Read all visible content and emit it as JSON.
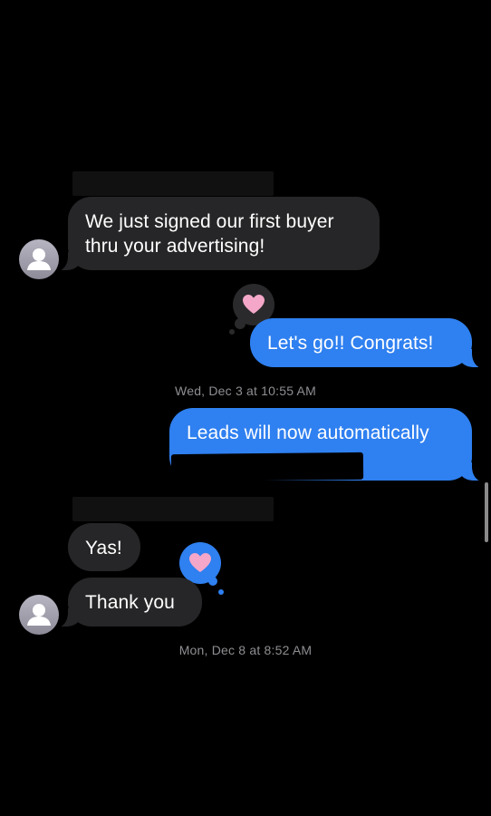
{
  "conversation": {
    "messages": [
      {
        "sender": "contact",
        "text": "We just signed our first buyer\nthru your advertising!"
      },
      {
        "sender": "me",
        "text": "Let's go!! Congrats!",
        "reaction": "heart"
      },
      {
        "sender": "me",
        "text": "Leads will now automatically"
      },
      {
        "sender": "contact",
        "text": "Yas!",
        "reaction": "heart"
      },
      {
        "sender": "contact",
        "text": "Thank you"
      }
    ],
    "timestamps": [
      "Wed, Dec 3 at 10:55 AM",
      "Mon, Dec 8 at 8:52 AM"
    ]
  },
  "colors": {
    "background": "#000000",
    "incoming_bubble": "#262628",
    "outgoing_bubble": "#2f80f0",
    "timestamp_text": "#8e8e93",
    "heart": "#f4a7c8"
  },
  "icons": {
    "avatar": "person-silhouette-icon",
    "reaction": "heart-icon"
  }
}
